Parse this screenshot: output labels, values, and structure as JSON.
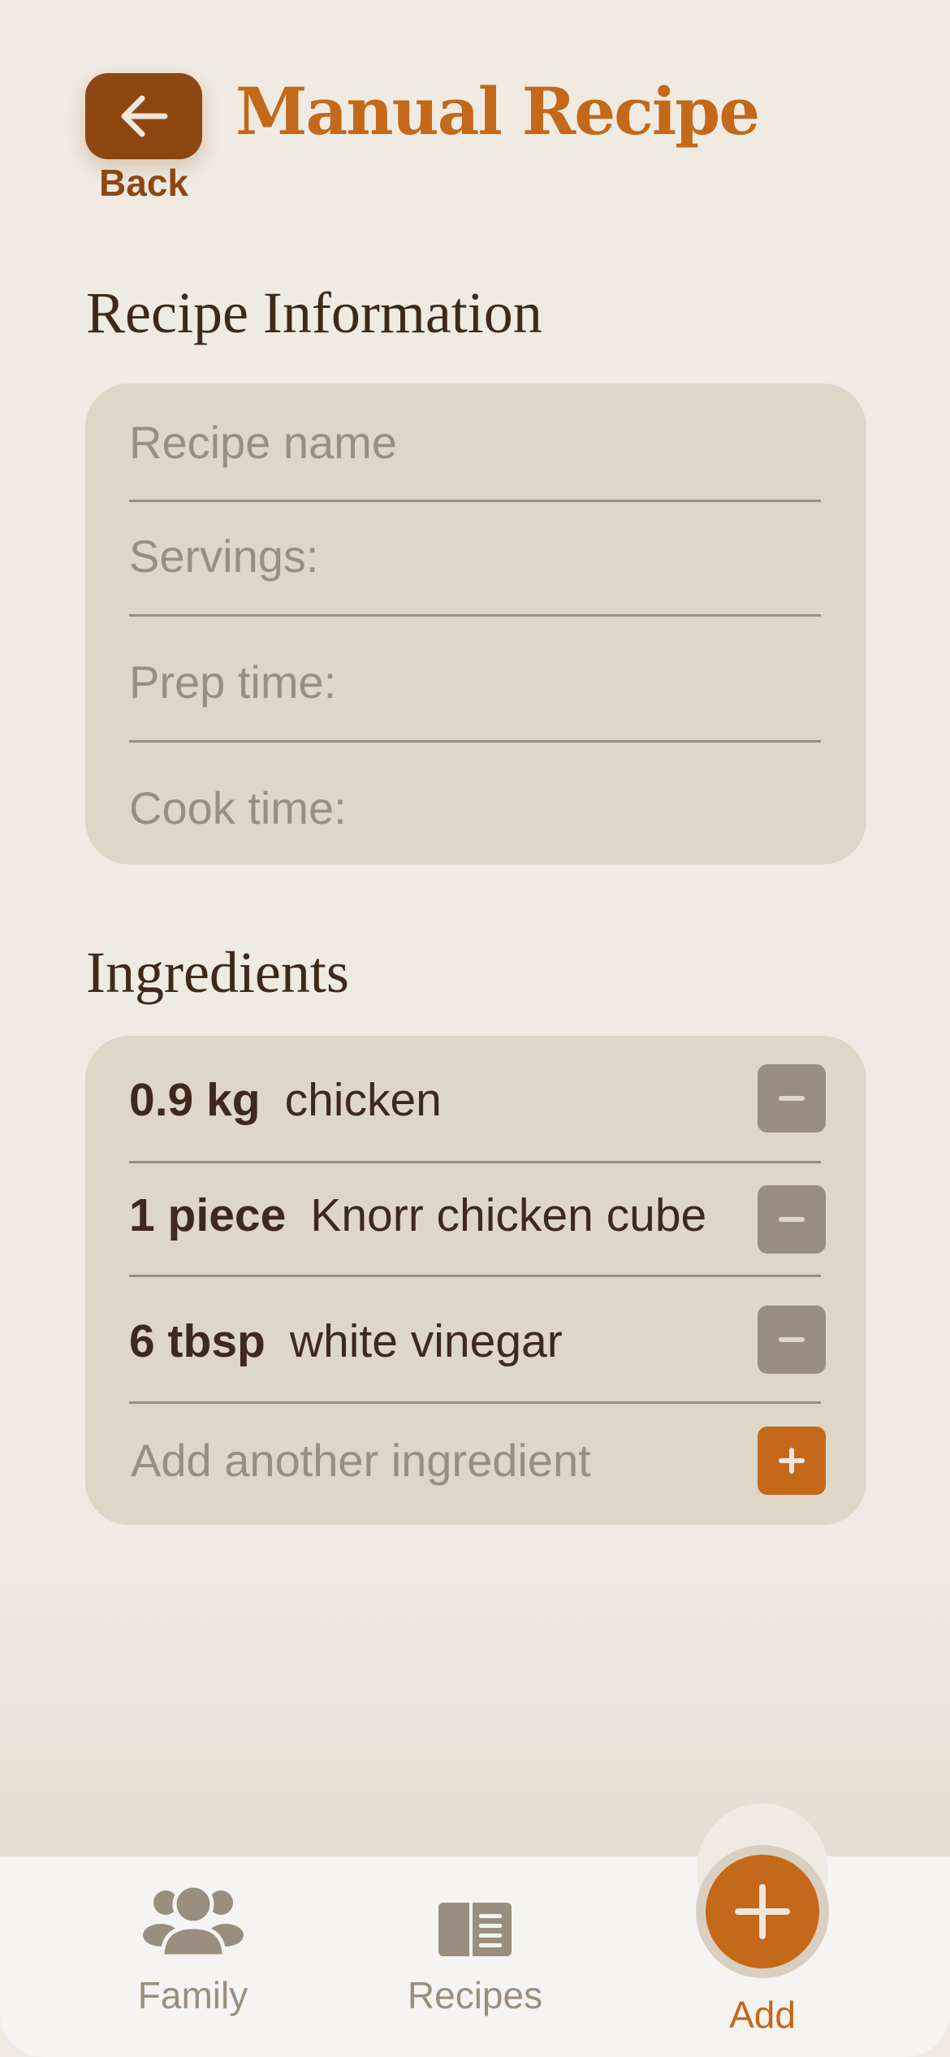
{
  "header": {
    "back_label": "Back",
    "title": "Manual Recipe"
  },
  "recipe_info": {
    "section_title": "Recipe Information",
    "name_placeholder": "Recipe name",
    "servings_placeholder": "Servings:",
    "prep_placeholder": "Prep time:",
    "cook_placeholder": "Cook time:"
  },
  "ingredients": {
    "section_title": "Ingredients",
    "items": [
      {
        "qty": "0.9 kg",
        "name": "chicken"
      },
      {
        "qty": "1 piece",
        "name": "Knorr chicken cube"
      },
      {
        "qty": "6 tbsp",
        "name": "white vinegar"
      }
    ],
    "add_placeholder": "Add another ingredient"
  },
  "nav": {
    "family_label": "Family",
    "recipes_label": "Recipes",
    "add_label": "Add"
  },
  "colors": {
    "accent": "#c4681a",
    "back_button": "#8f4711",
    "text_dark": "#3e2a1a",
    "muted": "#9a8f7e",
    "card": "#ded6c7",
    "background": "#efebe3"
  },
  "icons": [
    "arrow-left-icon",
    "minus-icon",
    "plus-icon",
    "family-icon",
    "recipe-book-icon",
    "add-icon"
  ]
}
